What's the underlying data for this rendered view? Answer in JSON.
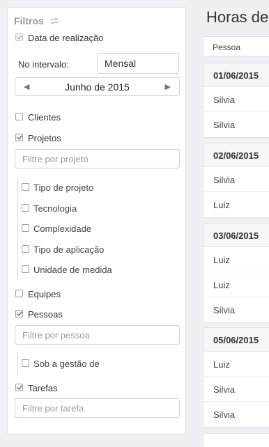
{
  "filters": {
    "title": "Filtros",
    "data_realizacao": {
      "label": "Data de realização",
      "checked": true
    },
    "intervalo": {
      "label": "No intervalo:",
      "value": "Mensal"
    },
    "month": {
      "label": "Junho de 2015",
      "prev": "◀",
      "next": "▶"
    },
    "clientes": {
      "label": "Clientes",
      "checked": false
    },
    "projetos": {
      "label": "Projetos",
      "checked": true,
      "placeholder": "Filtre por projeto"
    },
    "projeto_subfilters": [
      {
        "label": "Tipo de projeto"
      },
      {
        "label": "Tecnologia"
      },
      {
        "label": "Complexidade"
      },
      {
        "label": "Tipo de aplicação"
      },
      {
        "label": "Unidade de medida"
      }
    ],
    "equipes": {
      "label": "Equipes",
      "checked": false
    },
    "pessoas": {
      "label": "Pessoas",
      "checked": true,
      "placeholder": "Filtre por pessoa"
    },
    "gestao": {
      "label": "Sob a gestão de",
      "checked": false
    },
    "tarefas": {
      "label": "Tarefas",
      "checked": true,
      "placeholder": "Filtre por tarefa"
    }
  },
  "report": {
    "title": "Horas de",
    "column_header": "Pessoa",
    "groups": [
      {
        "date": "01/06/2015",
        "people": [
          "Silvia",
          "Silvia"
        ]
      },
      {
        "date": "02/06/2015",
        "people": [
          "Silvia",
          "Luiz"
        ]
      },
      {
        "date": "03/06/2015",
        "people": [
          "Luiz",
          "Luiz",
          "Silvia"
        ]
      },
      {
        "date": "05/06/2015",
        "people": [
          "Luiz",
          "Silvia",
          "Silvia"
        ]
      }
    ]
  }
}
